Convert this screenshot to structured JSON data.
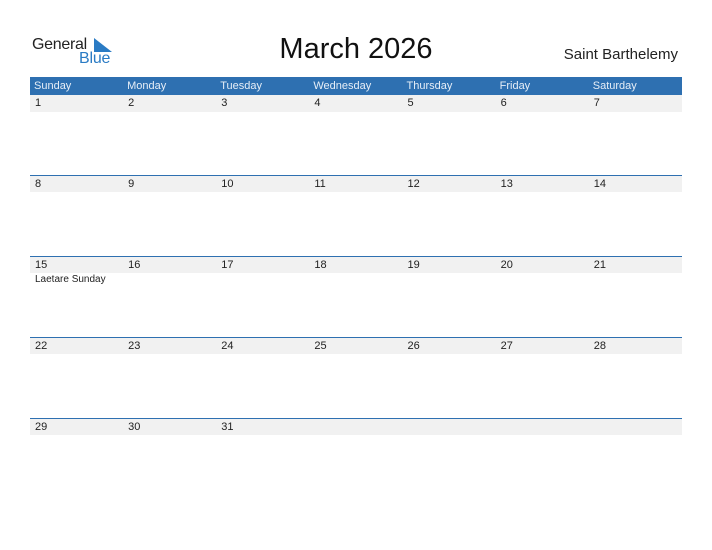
{
  "logo": {
    "line1": "General",
    "line2": "Blue"
  },
  "title": "March 2026",
  "country": "Saint Barthelemy",
  "colors": {
    "header_bg": "#2e70b1",
    "accent": "#2a7bc4",
    "day_bar": "#f1f1f1"
  },
  "weekdays": [
    "Sunday",
    "Monday",
    "Tuesday",
    "Wednesday",
    "Thursday",
    "Friday",
    "Saturday"
  ],
  "weeks": [
    {
      "days": [
        "1",
        "2",
        "3",
        "4",
        "5",
        "6",
        "7"
      ]
    },
    {
      "days": [
        "8",
        "9",
        "10",
        "11",
        "12",
        "13",
        "14"
      ]
    },
    {
      "days": [
        "15",
        "16",
        "17",
        "18",
        "19",
        "20",
        "21"
      ]
    },
    {
      "days": [
        "22",
        "23",
        "24",
        "25",
        "26",
        "27",
        "28"
      ]
    },
    {
      "days": [
        "29",
        "30",
        "31",
        "",
        "",
        "",
        ""
      ]
    }
  ],
  "events": [
    {
      "date": "15",
      "label": "Laetare Sunday"
    }
  ]
}
